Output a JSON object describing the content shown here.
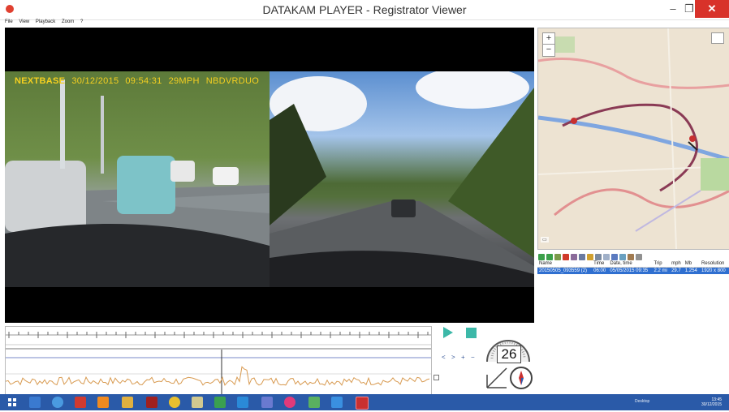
{
  "window": {
    "title": "DATAKAM PLAYER - Registrator Viewer",
    "minimize_glyph": "–",
    "maximize_glyph": "❐",
    "close_glyph": "✕"
  },
  "menu": {
    "items": [
      "File",
      "View",
      "Playback",
      "Zoom",
      "?"
    ]
  },
  "video": {
    "overlay": {
      "brand": "NEXTBASE",
      "date": "30/12/2015",
      "time": "09:54:31",
      "speed": "29MPH",
      "device": "NBDVRDUO"
    }
  },
  "map": {
    "zoom_in": "+",
    "zoom_out": "−"
  },
  "file_list": {
    "columns": [
      "Name",
      "Time",
      "Date, time",
      "Trip",
      "mph",
      "Mb",
      "Resolution"
    ],
    "rows": [
      {
        "name": "20150505_093559 (2)",
        "time": "06:00",
        "date_time": "05/05/2015 09:35",
        "trip": "2.2 mi",
        "mph": "29.7",
        "mb": "1.254",
        "resolution": "1920 x 800"
      }
    ]
  },
  "controls": {
    "prev": "<",
    "next": ">",
    "zoom_in": "+",
    "zoom_out": "−"
  },
  "speedometer": {
    "value": "26"
  },
  "taskbar": {
    "language": "Desktop",
    "time": "13:45",
    "date": "30/12/2015"
  },
  "colors": {
    "overlay_text": "#f5d020",
    "accent_teal": "#3cb8a8",
    "selection_blue": "#2f6fd0",
    "taskbar": "#2a5aa8",
    "close_red": "#d8322a"
  }
}
